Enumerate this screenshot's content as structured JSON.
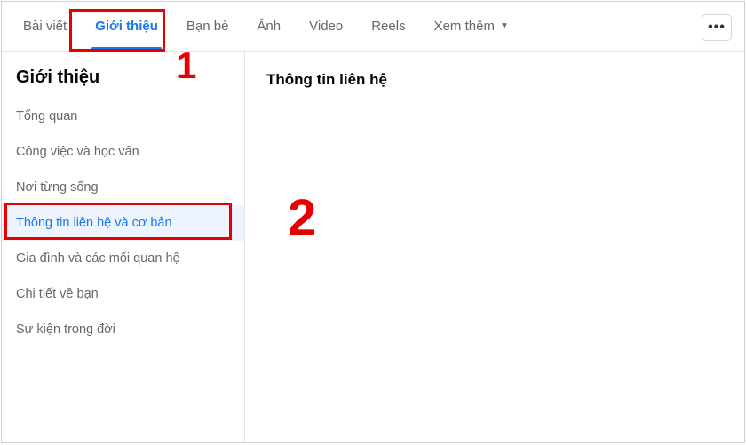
{
  "tabs": {
    "items": [
      {
        "label": "Bài viết"
      },
      {
        "label": "Giới thiệu"
      },
      {
        "label": "Bạn bè"
      },
      {
        "label": "Ảnh"
      },
      {
        "label": "Video"
      },
      {
        "label": "Reels"
      },
      {
        "label": "Xem thêm"
      }
    ],
    "more_button": "•••"
  },
  "sidebar": {
    "title": "Giới thiệu",
    "items": [
      {
        "label": "Tổng quan"
      },
      {
        "label": "Công việc và học vấn"
      },
      {
        "label": "Nơi từng sống"
      },
      {
        "label": "Thông tin liên hệ và cơ bản"
      },
      {
        "label": "Gia đình và các mối quan hệ"
      },
      {
        "label": "Chi tiết về bạn"
      },
      {
        "label": "Sự kiện trong đời"
      }
    ]
  },
  "content": {
    "heading": "Thông tin liên hệ"
  },
  "annotations": {
    "step1": "1",
    "step2": "2"
  }
}
